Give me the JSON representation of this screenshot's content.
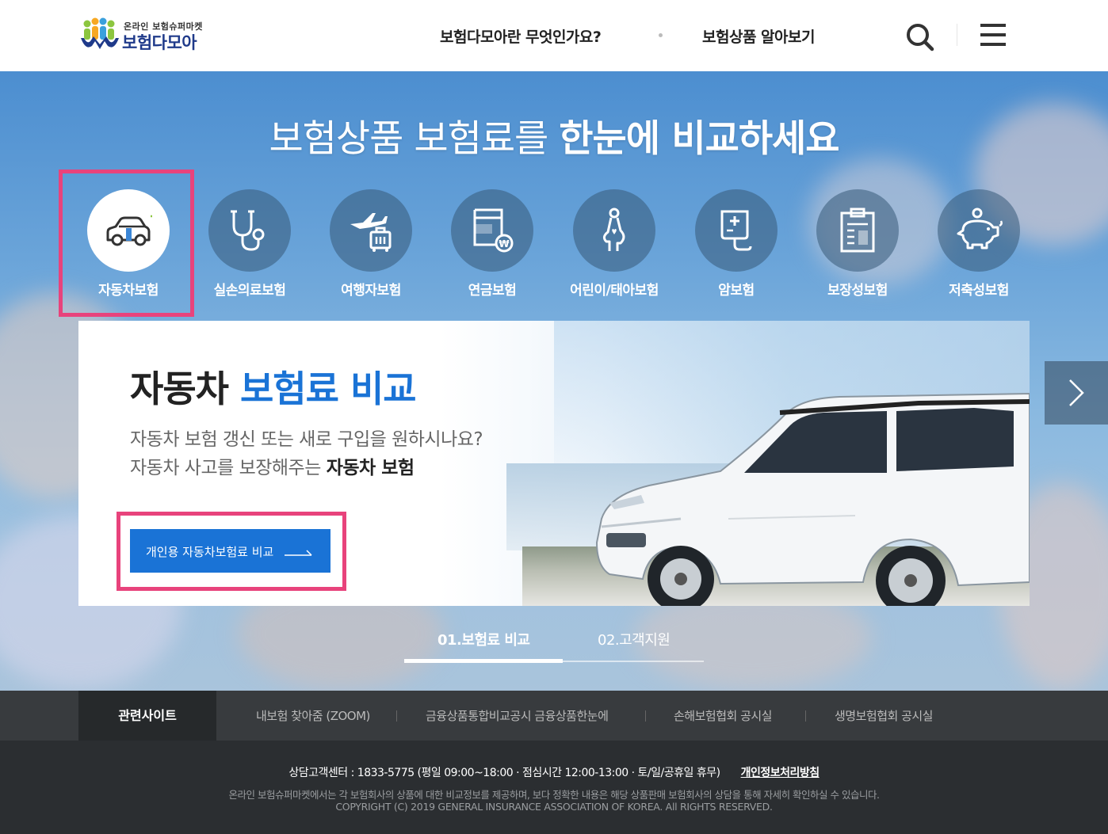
{
  "header": {
    "logo_small": "온라인 보험슈퍼마켓",
    "logo_big": "보험다모아",
    "nav": [
      "보험다모아란 무엇인가요?",
      "보험상품 알아보기"
    ]
  },
  "hero": {
    "title_light": "보험상품 보험료를 ",
    "title_bold": "한눈에 비교하세요",
    "categories": [
      {
        "label": "자동차보험",
        "icon": "car-icon"
      },
      {
        "label": "실손의료보험",
        "icon": "stethoscope-icon"
      },
      {
        "label": "여행자보험",
        "icon": "airplane-luggage-icon"
      },
      {
        "label": "연금보험",
        "icon": "pension-document-icon"
      },
      {
        "label": "어린이/태아보험",
        "icon": "pregnant-woman-icon"
      },
      {
        "label": "암보험",
        "icon": "medical-iv-icon"
      },
      {
        "label": "보장성보험",
        "icon": "clipboard-icon"
      },
      {
        "label": "저축성보험",
        "icon": "piggy-bank-icon"
      }
    ],
    "active_category": 0
  },
  "panel": {
    "title_dark": "자동차 ",
    "title_accent": "보험료 비교",
    "sub1": "자동차 보험 갱신 또는 새로 구입을 원하시나요?",
    "sub2_prefix": "자동차 사고를 보장해주는 ",
    "sub2_bold": "자동차 보험",
    "cta_label": "개인용 자동차보험료 비교"
  },
  "tabs": [
    "01.보험료 비교",
    "02.고객지원"
  ],
  "related": {
    "heading": "관련사이트",
    "links": [
      "내보험 찾아줌 (ZOOM)",
      "금융상품통합비교공시 금융상품한눈에",
      "손해보험협회 공시실",
      "생명보험협회 공시실"
    ]
  },
  "footer": {
    "contact": "상담고객센터 : 1833-5775 (평일 09:00~18:00 · 점심시간 12:00-13:00 · 토/일/공휴일 휴무)",
    "policy": "개인정보처리방침",
    "notice": "온라인 보험슈퍼마켓에서는 각 보험회사의 상품에 대한 비교정보를 제공하며, 보다 정확한 내용은 해당 상품판매 보험회사의 상담을 통해 자세히 확인하실 수 있습니다.",
    "copyright": "COPYRIGHT (C) 2019 GENERAL INSURANCE ASSOCIATION OF KOREA. All RIGHTS RESERVED."
  },
  "colors": {
    "accent": "#1a73d6",
    "highlight": "#e8437c",
    "logo_navy": "#1f3a8a"
  }
}
